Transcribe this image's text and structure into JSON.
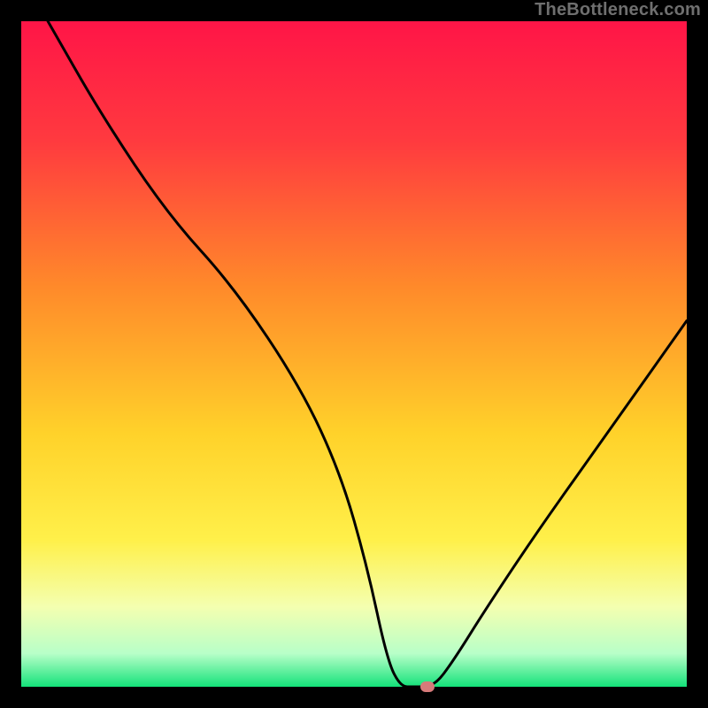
{
  "attribution": "TheBottleneck.com",
  "chart_data": {
    "type": "line",
    "title": "",
    "xlabel": "",
    "ylabel": "",
    "xlim": [
      0,
      100
    ],
    "ylim": [
      0,
      100
    ],
    "series": [
      {
        "name": "curve",
        "x": [
          4,
          12,
          22,
          32,
          42,
          48,
          52,
          55,
          57,
          59,
          62,
          65,
          70,
          78,
          88,
          100
        ],
        "values": [
          100,
          86,
          71,
          60,
          45,
          32,
          18,
          4,
          0,
          0,
          0,
          4,
          12,
          24,
          38,
          55
        ]
      }
    ],
    "marker": {
      "x": 61,
      "y": 0,
      "color": "#d77a7a"
    },
    "gradient_stops": [
      {
        "offset": 0,
        "color": "#ff1547"
      },
      {
        "offset": 18,
        "color": "#ff3a3f"
      },
      {
        "offset": 40,
        "color": "#ff8a2a"
      },
      {
        "offset": 62,
        "color": "#ffd22a"
      },
      {
        "offset": 78,
        "color": "#fff04a"
      },
      {
        "offset": 88,
        "color": "#f4ffb0"
      },
      {
        "offset": 95,
        "color": "#b8ffc8"
      },
      {
        "offset": 100,
        "color": "#14e27a"
      }
    ]
  }
}
